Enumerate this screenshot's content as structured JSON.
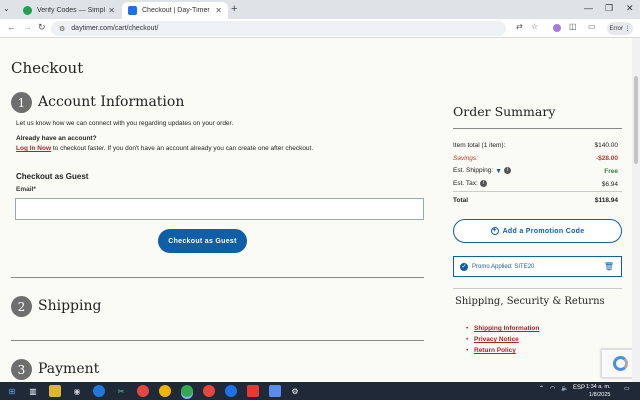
{
  "browser": {
    "tabs": [
      {
        "title": "Verify Codes — SimplyCodes",
        "active": false
      },
      {
        "title": "Checkout | Day-Timer",
        "active": true
      }
    ],
    "url": "daytimer.com/cart/checkout/",
    "error_label": "Error"
  },
  "page": {
    "title": "Checkout",
    "account": {
      "step": "1",
      "heading": "Account Information",
      "intro": "Let us know how we can connect with you regarding updates on your order.",
      "already_q": "Already have an account?",
      "login_link": "Log In Now",
      "login_rest": " to checkout faster. If you don't have an account already you can create one after checkout.",
      "guest_heading": "Checkout as Guest",
      "email_label": "Email*",
      "email_value": "",
      "guest_button": "Checkout as Guest"
    },
    "shipping": {
      "step": "2",
      "heading": "Shipping"
    },
    "payment": {
      "step": "3",
      "heading": "Payment"
    }
  },
  "summary": {
    "title": "Order Summary",
    "rows": [
      {
        "label": "Item total (1 item):",
        "value": "$140.00"
      },
      {
        "label": "Savings:",
        "value": "-$28.00"
      },
      {
        "label": "Est. Shipping:",
        "value": "Free"
      },
      {
        "label": "Est. Tax:",
        "value": "$6.94"
      },
      {
        "label": "Total",
        "value": "$118.94"
      }
    ],
    "promo_button": "Add a Promotion Code",
    "promo_applied": "Promo Applied: SITE20"
  },
  "policies": {
    "title": "Shipping, Security & Returns",
    "links": [
      "Shipping Information",
      "Privacy Notice",
      "Return Policy"
    ]
  },
  "taskbar": {
    "lang": "ESP",
    "time": "1:34 a. m.",
    "date": "1/8/2025"
  },
  "colors": {
    "brand_blue": "#0f5ea8",
    "link_red": "#b3202a",
    "savings_red": "#c0392b",
    "free_green": "#2e7d32"
  }
}
